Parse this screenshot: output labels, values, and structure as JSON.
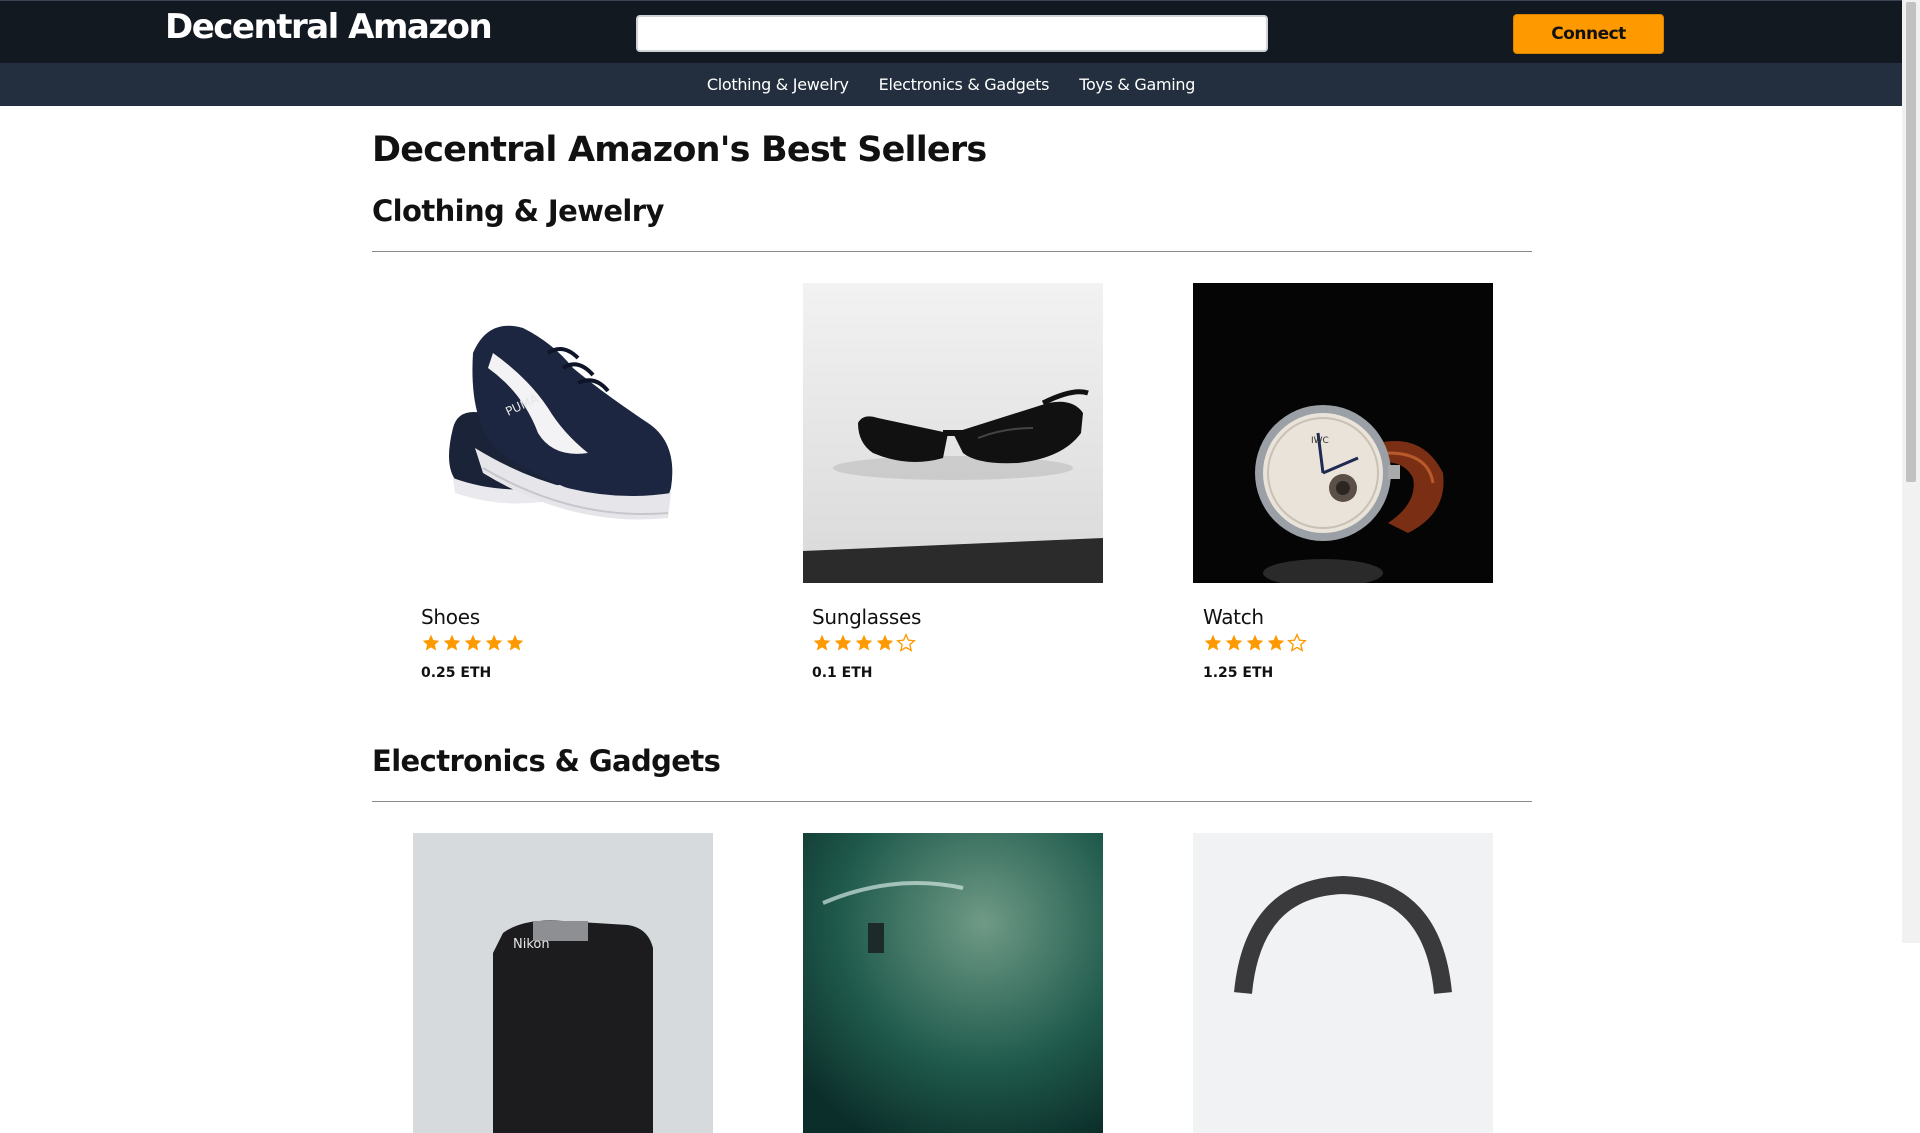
{
  "header": {
    "logo": "Decentral Amazon",
    "search_value": "",
    "connect_label": "Connect"
  },
  "nav": {
    "items": [
      "Clothing & Jewelry",
      "Electronics & Gadgets",
      "Toys & Gaming"
    ]
  },
  "main": {
    "title": "Decentral Amazon's Best Sellers",
    "sections": [
      {
        "title": "Clothing & Jewelry",
        "products": [
          {
            "name": "Shoes",
            "rating": 5,
            "price": "0.25 ETH",
            "image": "shoe-image"
          },
          {
            "name": "Sunglasses",
            "rating": 4,
            "price": "0.1 ETH",
            "image": "sunglasses-image"
          },
          {
            "name": "Watch",
            "rating": 4,
            "price": "1.25 ETH",
            "image": "watch-image"
          }
        ]
      },
      {
        "title": "Electronics & Gadgets",
        "products": [
          {
            "image": "camera-image"
          },
          {
            "image": "drone-image"
          },
          {
            "image": "headphones-image"
          }
        ]
      }
    ]
  },
  "colors": {
    "header_bg": "#131921",
    "nav_bg": "#232f3e",
    "accent": "#ff9900",
    "star": "#ff9900"
  }
}
